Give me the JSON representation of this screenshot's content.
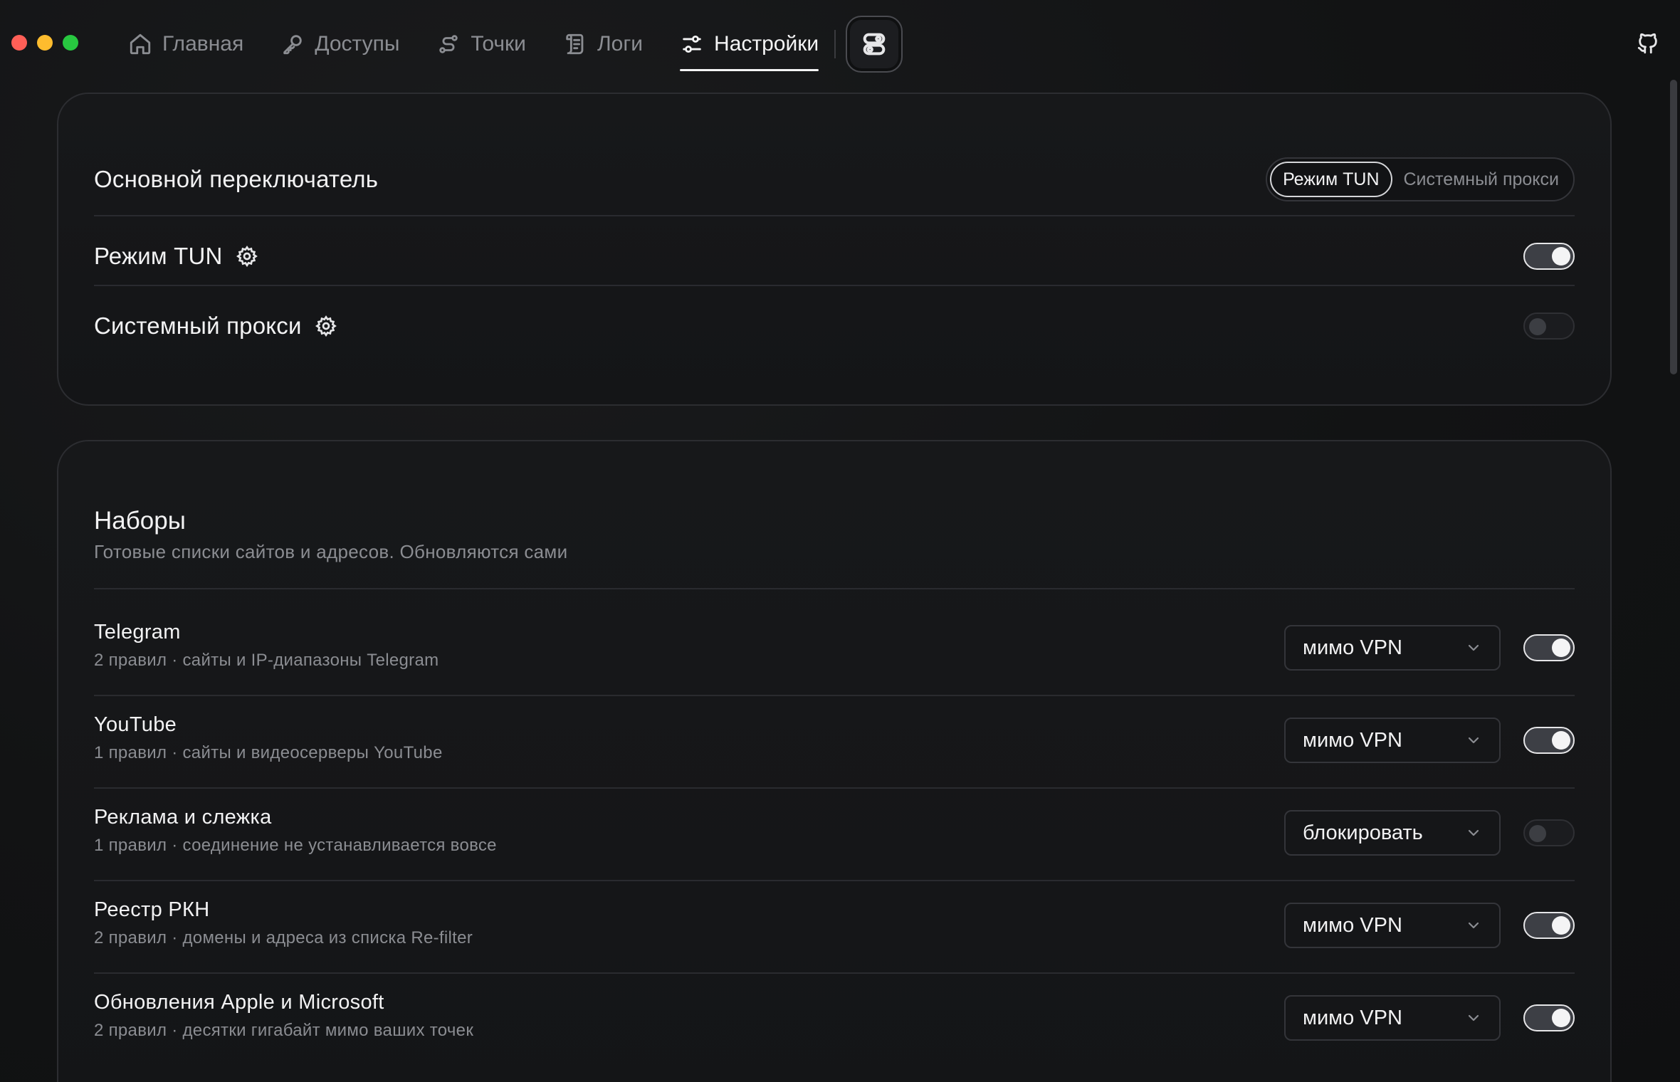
{
  "colors": {
    "background": "#121314",
    "accent": "#f4f4f5",
    "muted_text": "#8b8d92",
    "traffic_red": "#ff5f57",
    "traffic_yellow": "#febc2e",
    "traffic_green": "#28c840"
  },
  "nav": {
    "items": [
      {
        "label": "Главная",
        "icon": "home-icon",
        "active": false
      },
      {
        "label": "Доступы",
        "icon": "key-icon",
        "active": false
      },
      {
        "label": "Точки",
        "icon": "route-icon",
        "active": false
      },
      {
        "label": "Логи",
        "icon": "scroll-icon",
        "active": false
      },
      {
        "label": "Настройки",
        "icon": "sliders-icon",
        "active": true
      }
    ],
    "extra_button_icon": "switches-icon",
    "github_icon": "github-icon"
  },
  "main_switch": {
    "title": "Основной переключатель",
    "segments": [
      "Режим TUN",
      "Системный прокси"
    ],
    "active_segment": 0,
    "tun": {
      "label": "Режим TUN",
      "enabled": true,
      "icon": "gear-icon"
    },
    "proxy": {
      "label": "Системный прокси",
      "enabled": false,
      "icon": "gear-icon"
    }
  },
  "sets": {
    "title": "Наборы",
    "subtitle": "Готовые списки сайтов и адресов. Обновляются сами",
    "items": [
      {
        "name": "Telegram",
        "desc": "2 правил · сайты и IP-диапазоны Telegram",
        "action": "мимо VPN",
        "enabled": true
      },
      {
        "name": "YouTube",
        "desc": "1 правил · сайты и видеосерверы YouTube",
        "action": "мимо VPN",
        "enabled": true
      },
      {
        "name": "Реклама и слежка",
        "desc": "1 правил · соединение не устанавливается вовсе",
        "action": "блокировать",
        "enabled": false
      },
      {
        "name": "Реестр РКН",
        "desc": "2 правил · домены и адреса из списка Re-filter",
        "action": "мимо VPN",
        "enabled": true
      },
      {
        "name": "Обновления Apple и Microsoft",
        "desc": "2 правил · десятки гигабайт мимо ваших точек",
        "action": "мимо VPN",
        "enabled": true
      }
    ]
  }
}
